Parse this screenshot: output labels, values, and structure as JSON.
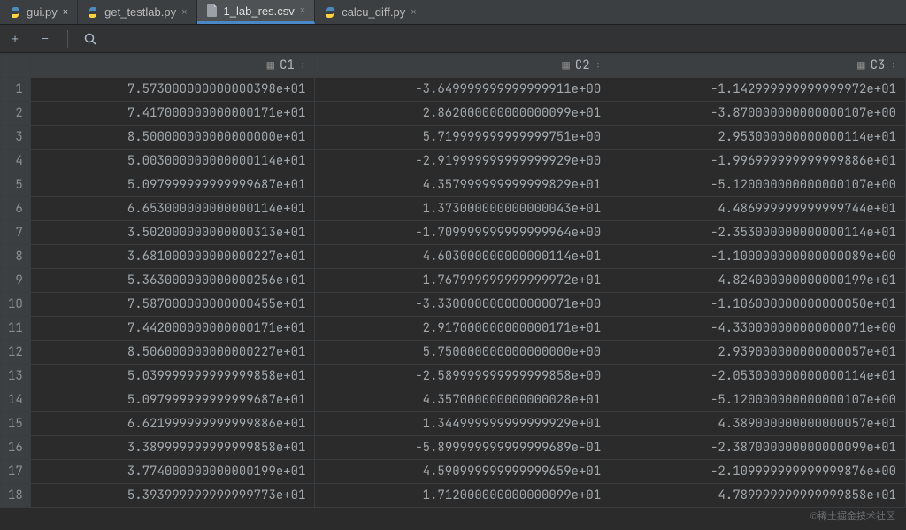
{
  "tabs": [
    {
      "label": "gui.py",
      "icon": "py",
      "active": false
    },
    {
      "label": "get_testlab.py",
      "icon": "py",
      "active": false
    },
    {
      "label": "1_lab_res.csv",
      "icon": "file",
      "active": true
    },
    {
      "label": "calcu_diff.py",
      "icon": "py",
      "active": false
    }
  ],
  "toolbar": {
    "add_tip": "+",
    "remove_tip": "−",
    "search_tip": "Search"
  },
  "columns": [
    "C1",
    "C2",
    "C3"
  ],
  "sort_symbol": "÷",
  "rows": [
    {
      "n": 1,
      "c1": "7.573000000000000398e+01",
      "c2": "-3.649999999999999911e+00",
      "c3": "-1.142999999999999972e+01"
    },
    {
      "n": 2,
      "c1": "7.417000000000000171e+01",
      "c2": "2.862000000000000099e+01",
      "c3": "-3.870000000000000107e+00"
    },
    {
      "n": 3,
      "c1": "8.500000000000000000e+01",
      "c2": "5.719999999999999751e+00",
      "c3": "2.953000000000000114e+01"
    },
    {
      "n": 4,
      "c1": "5.003000000000000114e+01",
      "c2": "-2.919999999999999929e+00",
      "c3": "-1.996999999999999886e+01"
    },
    {
      "n": 5,
      "c1": "5.097999999999999687e+01",
      "c2": "4.357999999999999829e+01",
      "c3": "-5.120000000000000107e+00"
    },
    {
      "n": 6,
      "c1": "6.653000000000000114e+01",
      "c2": "1.373000000000000043e+01",
      "c3": "4.486999999999999744e+01"
    },
    {
      "n": 7,
      "c1": "3.502000000000000313e+01",
      "c2": "-1.709999999999999964e+00",
      "c3": "-2.353000000000000114e+01"
    },
    {
      "n": 8,
      "c1": "3.681000000000000227e+01",
      "c2": "4.603000000000000114e+01",
      "c3": "-1.100000000000000089e+00"
    },
    {
      "n": 9,
      "c1": "5.363000000000000256e+01",
      "c2": "1.767999999999999972e+01",
      "c3": "4.824000000000000199e+01"
    },
    {
      "n": 10,
      "c1": "7.587000000000000455e+01",
      "c2": "-3.330000000000000071e+00",
      "c3": "-1.106000000000000050e+01"
    },
    {
      "n": 11,
      "c1": "7.442000000000000171e+01",
      "c2": "2.917000000000000171e+01",
      "c3": "-4.330000000000000071e+00"
    },
    {
      "n": 12,
      "c1": "8.506000000000000227e+01",
      "c2": "5.750000000000000000e+00",
      "c3": "2.939000000000000057e+01"
    },
    {
      "n": 13,
      "c1": "5.039999999999999858e+01",
      "c2": "-2.589999999999999858e+00",
      "c3": "-2.053000000000000114e+01"
    },
    {
      "n": 14,
      "c1": "5.097999999999999687e+01",
      "c2": "4.357000000000000028e+01",
      "c3": "-5.120000000000000107e+00"
    },
    {
      "n": 15,
      "c1": "6.621999999999999886e+01",
      "c2": "1.344999999999999929e+01",
      "c3": "4.389000000000000057e+01"
    },
    {
      "n": 16,
      "c1": "3.389999999999999858e+01",
      "c2": "-5.899999999999999689e-01",
      "c3": "-2.387000000000000099e+01"
    },
    {
      "n": 17,
      "c1": "3.774000000000000199e+01",
      "c2": "4.590999999999999659e+01",
      "c3": "-2.109999999999999876e+00"
    },
    {
      "n": 18,
      "c1": "5.393999999999999773e+01",
      "c2": "1.712000000000000099e+01",
      "c3": "4.789999999999999858e+01"
    }
  ],
  "watermark": "©稀土掘金技术社区",
  "chart_data": {
    "type": "table",
    "title": "1_lab_res.csv",
    "columns": [
      "C1",
      "C2",
      "C3"
    ],
    "series": [
      {
        "name": "C1",
        "values": [
          75.73,
          74.17,
          85.0,
          50.03,
          50.98,
          66.53,
          35.02,
          36.81,
          53.63,
          75.87,
          74.42,
          85.06,
          50.4,
          50.98,
          66.22,
          33.9,
          37.74,
          53.94
        ]
      },
      {
        "name": "C2",
        "values": [
          -3.65,
          28.62,
          5.72,
          -2.92,
          43.58,
          13.73,
          -1.71,
          46.03,
          17.68,
          -3.33,
          29.17,
          5.75,
          -2.59,
          43.57,
          13.45,
          -0.59,
          45.91,
          17.12
        ]
      },
      {
        "name": "C3",
        "values": [
          -11.43,
          -3.87,
          29.53,
          -19.97,
          -5.12,
          44.87,
          -23.53,
          -1.1,
          48.24,
          -11.06,
          -4.33,
          29.39,
          -20.53,
          -5.12,
          43.89,
          -23.87,
          -2.11,
          47.9
        ]
      }
    ]
  }
}
